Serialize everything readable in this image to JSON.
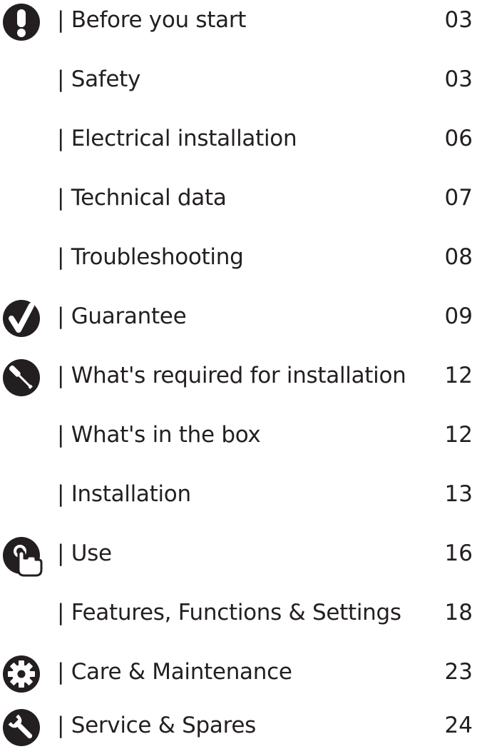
{
  "toc": {
    "entries": [
      {
        "title": "| Before you start",
        "page": "03",
        "icon": "exclamation-icon"
      },
      {
        "title": "| Safety",
        "page": "03",
        "icon": ""
      },
      {
        "title": "| Electrical installation",
        "page": "06",
        "icon": ""
      },
      {
        "title": "| Technical data",
        "page": "07",
        "icon": ""
      },
      {
        "title": "| Troubleshooting",
        "page": "08",
        "icon": ""
      },
      {
        "title": "| Guarantee",
        "page": "09",
        "icon": "checkmark-icon"
      },
      {
        "title": "| What's required for installation",
        "page": "12",
        "icon": "screwdriver-icon"
      },
      {
        "title": "| What's in the box",
        "page": "12",
        "icon": ""
      },
      {
        "title": "| Installation",
        "page": "13",
        "icon": ""
      },
      {
        "title": "| Use",
        "page": "16",
        "icon": "touch-hand-icon"
      },
      {
        "title": "| Features, Functions & Settings",
        "page": "18",
        "icon": ""
      },
      {
        "title": "| Care & Maintenance",
        "page": "23",
        "icon": "gear-icon"
      },
      {
        "title": "| Service & Spares",
        "page": "24",
        "icon": "wrench-icon"
      }
    ],
    "icon_color": "#231f20",
    "text_color": "#231f20"
  }
}
